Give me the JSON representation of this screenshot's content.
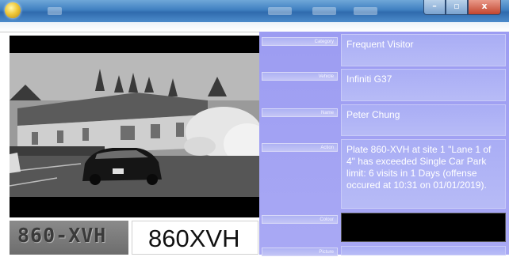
{
  "window": {
    "minimize_label": "–",
    "maximize_label": "▫",
    "close_label": "x"
  },
  "plate_crop_text": "860-XVH",
  "plate_read": "860XVH",
  "fields": {
    "category": {
      "label": "Category",
      "value": "Frequent Visitor"
    },
    "vehicle": {
      "label": "Vehicle",
      "value": "Infiniti G37"
    },
    "name": {
      "label": "Name",
      "value": "Peter Chung"
    },
    "action": {
      "label": "Action",
      "value": "Plate 860-XVH at site 1 \"Lane 1 of 4\" has exceeded Single Car Park limit: 6 visits in 1 Days (offense occured at 10:31 on 01/01/2019)."
    },
    "colour": {
      "label": "Colour",
      "value": ""
    },
    "picture": {
      "label": "Picture",
      "value": ""
    }
  },
  "colors": {
    "panel": "#a3a3f3",
    "colour_swatch": "#000000"
  }
}
